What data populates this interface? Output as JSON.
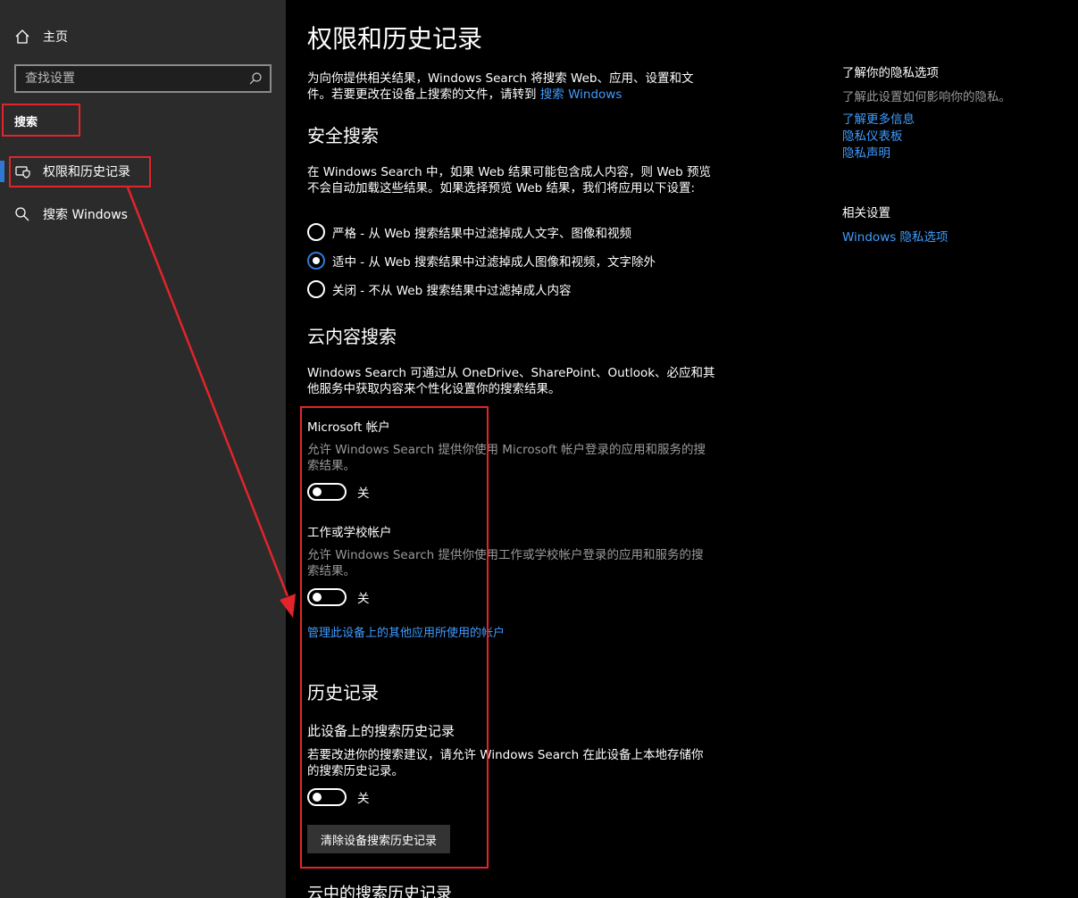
{
  "sidebar": {
    "home_label": "主页",
    "search_placeholder": "查找设置",
    "section_label": "搜索",
    "items": [
      {
        "label": "权限和历史记录",
        "icon": "permissions-icon",
        "selected": true
      },
      {
        "label": "搜索 Windows",
        "icon": "search-icon",
        "selected": false
      }
    ]
  },
  "main": {
    "title": "权限和历史记录",
    "intro_line1": "为向你提供相关结果，Windows Search 将搜索 Web、应用、设置和文",
    "intro_line2": "件。若要更改在设备上搜索的文件，请转到",
    "intro_link": "搜索 Windows",
    "safe_search": {
      "heading": "安全搜索",
      "desc_line1": "在 Windows Search 中，如果 Web 结果可能包含成人内容，则 Web 预览",
      "desc_line2": "不会自动加载这些结果。如果选择预览 Web 结果，我们将应用以下设置:",
      "options": [
        {
          "label": "严格 - 从 Web 搜索结果中过滤掉成人文字、图像和视频",
          "checked": false
        },
        {
          "label": "适中 - 从 Web 搜索结果中过滤掉成人图像和视频，文字除外",
          "checked": true
        },
        {
          "label": "关闭 - 不从 Web 搜索结果中过滤掉成人内容",
          "checked": false
        }
      ]
    },
    "cloud": {
      "heading": "云内容搜索",
      "desc_line1": "Windows Search 可通过从 OneDrive、SharePoint、Outlook、必应和其",
      "desc_line2": "他服务中获取内容来个性化设置你的搜索结果。",
      "ms_account_title": "Microsoft 帐户",
      "ms_account_desc_line1": "允许 Windows Search 提供你使用 Microsoft 帐户登录的应用和服务的搜",
      "ms_account_desc_line2": "索结果。",
      "ms_account_state": "关",
      "work_title": "工作或学校帐户",
      "work_desc_line1": "允许 Windows Search 提供你使用工作或学校帐户登录的应用和服务的搜",
      "work_desc_line2": "索结果。",
      "work_state": "关",
      "manage_link": "管理此设备上的其他应用所使用的帐户"
    },
    "history": {
      "heading": "历史记录",
      "device_title": "此设备上的搜索历史记录",
      "device_desc_line1": "若要改进你的搜索建议，请允许 Windows Search 在此设备上本地存储你",
      "device_desc_line2": "的搜索历史记录。",
      "device_state": "关",
      "clear_button": "清除设备搜索历史记录",
      "cloud_heading": "云中的搜索历史记录"
    }
  },
  "right": {
    "privacy_heading": "了解你的隐私选项",
    "privacy_desc": "了解此设置如何影响你的隐私。",
    "links": [
      "了解更多信息",
      "隐私仪表板",
      "隐私声明"
    ],
    "related_heading": "相关设置",
    "related_link": "Windows 隐私选项"
  },
  "colors": {
    "accent": "#2f79d4",
    "link": "#3f9cff",
    "annotation": "#e3242b",
    "sidebar_bg": "#2b2b2b"
  }
}
